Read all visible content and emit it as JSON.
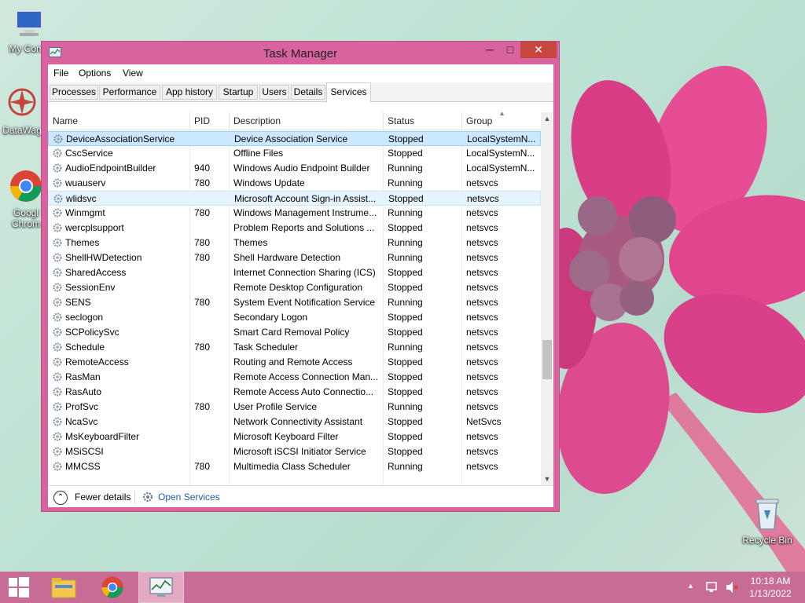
{
  "desktop": {
    "icons": [
      {
        "label": "My Comp"
      },
      {
        "label": "DataWag"
      },
      {
        "label": "Googl Chrom"
      },
      {
        "label": "Recycle Bin"
      }
    ]
  },
  "window": {
    "title": "Task Manager",
    "menu": [
      "File",
      "Options",
      "View"
    ],
    "tabs": [
      "Processes",
      "Performance",
      "App history",
      "Startup",
      "Users",
      "Details",
      "Services"
    ],
    "active_tab": "Services",
    "columns": [
      "Name",
      "PID",
      "Description",
      "Status",
      "Group"
    ],
    "rows": [
      {
        "name": "DeviceAssociationService",
        "pid": "",
        "desc": "Device Association Service",
        "status": "Stopped",
        "group": "LocalSystemN..."
      },
      {
        "name": "CscService",
        "pid": "",
        "desc": "Offline Files",
        "status": "Stopped",
        "group": "LocalSystemN..."
      },
      {
        "name": "AudioEndpointBuilder",
        "pid": "940",
        "desc": "Windows Audio Endpoint Builder",
        "status": "Running",
        "group": "LocalSystemN..."
      },
      {
        "name": "wuauserv",
        "pid": "780",
        "desc": "Windows Update",
        "status": "Running",
        "group": "netsvcs"
      },
      {
        "name": "wlidsvc",
        "pid": "",
        "desc": "Microsoft Account Sign-in Assist...",
        "status": "Stopped",
        "group": "netsvcs"
      },
      {
        "name": "Winmgmt",
        "pid": "780",
        "desc": "Windows Management Instrume...",
        "status": "Running",
        "group": "netsvcs"
      },
      {
        "name": "wercplsupport",
        "pid": "",
        "desc": "Problem Reports and Solutions ...",
        "status": "Stopped",
        "group": "netsvcs"
      },
      {
        "name": "Themes",
        "pid": "780",
        "desc": "Themes",
        "status": "Running",
        "group": "netsvcs"
      },
      {
        "name": "ShellHWDetection",
        "pid": "780",
        "desc": "Shell Hardware Detection",
        "status": "Running",
        "group": "netsvcs"
      },
      {
        "name": "SharedAccess",
        "pid": "",
        "desc": "Internet Connection Sharing (ICS)",
        "status": "Stopped",
        "group": "netsvcs"
      },
      {
        "name": "SessionEnv",
        "pid": "",
        "desc": "Remote Desktop Configuration",
        "status": "Stopped",
        "group": "netsvcs"
      },
      {
        "name": "SENS",
        "pid": "780",
        "desc": "System Event Notification Service",
        "status": "Running",
        "group": "netsvcs"
      },
      {
        "name": "seclogon",
        "pid": "",
        "desc": "Secondary Logon",
        "status": "Stopped",
        "group": "netsvcs"
      },
      {
        "name": "SCPolicySvc",
        "pid": "",
        "desc": "Smart Card Removal Policy",
        "status": "Stopped",
        "group": "netsvcs"
      },
      {
        "name": "Schedule",
        "pid": "780",
        "desc": "Task Scheduler",
        "status": "Running",
        "group": "netsvcs"
      },
      {
        "name": "RemoteAccess",
        "pid": "",
        "desc": "Routing and Remote Access",
        "status": "Stopped",
        "group": "netsvcs"
      },
      {
        "name": "RasMan",
        "pid": "",
        "desc": "Remote Access Connection Man...",
        "status": "Stopped",
        "group": "netsvcs"
      },
      {
        "name": "RasAuto",
        "pid": "",
        "desc": "Remote Access Auto Connectio...",
        "status": "Stopped",
        "group": "netsvcs"
      },
      {
        "name": "ProfSvc",
        "pid": "780",
        "desc": "User Profile Service",
        "status": "Running",
        "group": "netsvcs"
      },
      {
        "name": "NcaSvc",
        "pid": "",
        "desc": "Network Connectivity Assistant",
        "status": "Stopped",
        "group": "NetSvcs"
      },
      {
        "name": "MsKeyboardFilter",
        "pid": "",
        "desc": "Microsoft Keyboard Filter",
        "status": "Stopped",
        "group": "netsvcs"
      },
      {
        "name": "MSiSCSI",
        "pid": "",
        "desc": "Microsoft iSCSI Initiator Service",
        "status": "Stopped",
        "group": "netsvcs"
      },
      {
        "name": "MMCSS",
        "pid": "780",
        "desc": "Multimedia Class Scheduler",
        "status": "Running",
        "group": "netsvcs"
      }
    ],
    "selected_row": 0,
    "hovered_row": 4,
    "footer": {
      "fewer_details": "Fewer details",
      "open_services": "Open Services"
    }
  },
  "taskbar": {
    "time": "10:18 AM",
    "date": "1/13/2022"
  },
  "colors": {
    "window_frame": "#d9639f",
    "taskbar": "#c76d95",
    "close_button": "#c7463f",
    "selection": "#cce8ff",
    "link": "#1e5fa8"
  }
}
